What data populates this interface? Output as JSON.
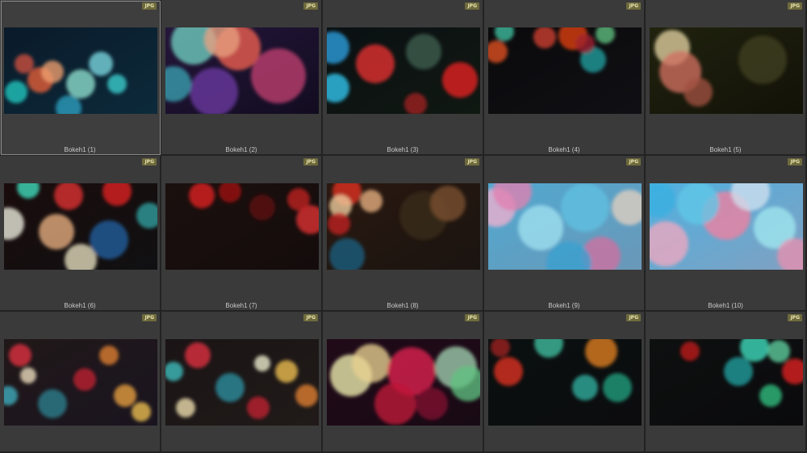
{
  "badge_label": "JPG",
  "items": [
    {
      "label": "Bokeh1 (1)",
      "selected": true,
      "bg": [
        "#0a1a2a",
        "#0c2a3a"
      ],
      "blobs": [
        [
          "#1ec8c0",
          15,
          80,
          14
        ],
        [
          "#e8603a",
          45,
          65,
          16
        ],
        [
          "#f0a070",
          60,
          55,
          14
        ],
        [
          "#90e0d0",
          95,
          70,
          18
        ],
        [
          "#7ad8e0",
          120,
          45,
          15
        ],
        [
          "#2aa0c0",
          80,
          100,
          16
        ],
        [
          "#3cd0d0",
          140,
          70,
          12
        ],
        [
          "#d05040",
          25,
          45,
          12
        ]
      ]
    },
    {
      "label": "Bokeh1 (2)",
      "selected": false,
      "bg": [
        "#24163a",
        "#120c20"
      ],
      "blobs": [
        [
          "#6fd0c0",
          35,
          18,
          28
        ],
        [
          "#f06050",
          90,
          25,
          28
        ],
        [
          "#e8a080",
          70,
          15,
          22
        ],
        [
          "#c04070",
          140,
          60,
          34
        ],
        [
          "#6a3aa0",
          60,
          80,
          30
        ],
        [
          "#3aa0b0",
          10,
          70,
          22
        ]
      ]
    },
    {
      "label": "Bokeh1 (3)",
      "selected": false,
      "bg": [
        "#0a1012",
        "#101812"
      ],
      "blobs": [
        [
          "#30c8f0",
          10,
          75,
          18
        ],
        [
          "#e83030",
          60,
          45,
          24
        ],
        [
          "#e82020",
          165,
          65,
          22
        ],
        [
          "#2aa0e0",
          8,
          25,
          20
        ],
        [
          "#406050",
          120,
          30,
          22
        ],
        [
          "#a02020",
          110,
          95,
          14
        ]
      ]
    },
    {
      "label": "Bokeh1 (4)",
      "selected": false,
      "bg": [
        "#0a0a0c",
        "#101014"
      ],
      "blobs": [
        [
          "#e04010",
          105,
          10,
          18
        ],
        [
          "#e05020",
          10,
          30,
          14
        ],
        [
          "#40c0a0",
          20,
          5,
          12
        ],
        [
          "#60c080",
          145,
          8,
          12
        ],
        [
          "#d04030",
          70,
          12,
          14
        ],
        [
          "#20a0a0",
          130,
          40,
          16
        ],
        [
          "#a02030",
          120,
          20,
          12
        ]
      ]
    },
    {
      "label": "Bokeh1 (5)",
      "selected": false,
      "bg": [
        "#20220e",
        "#121208"
      ],
      "blobs": [
        [
          "#e0d0a0",
          28,
          25,
          22
        ],
        [
          "#d07060",
          38,
          55,
          26
        ],
        [
          "#a05040",
          60,
          80,
          18
        ],
        [
          "#404020",
          140,
          40,
          30
        ]
      ]
    },
    {
      "label": "Bokeh1 (6)",
      "selected": false,
      "bg": [
        "#1a0c0c",
        "#101012"
      ],
      "blobs": [
        [
          "#f0f0e0",
          5,
          50,
          20
        ],
        [
          "#e8e0c0",
          95,
          95,
          20
        ],
        [
          "#e8b080",
          65,
          60,
          22
        ],
        [
          "#e03030",
          80,
          15,
          18
        ],
        [
          "#e02020",
          140,
          10,
          18
        ],
        [
          "#30a0a0",
          180,
          40,
          16
        ],
        [
          "#40e0c0",
          30,
          5,
          14
        ],
        [
          "#2060a0",
          130,
          70,
          24
        ]
      ]
    },
    {
      "label": "Bokeh1 (7)",
      "selected": false,
      "bg": [
        "#1a100e",
        "#140c0c"
      ],
      "blobs": [
        [
          "#e02020",
          45,
          15,
          16
        ],
        [
          "#a01010",
          80,
          10,
          14
        ],
        [
          "#e03030",
          180,
          45,
          18
        ],
        [
          "#c02020",
          165,
          20,
          14
        ],
        [
          "#601010",
          120,
          30,
          16
        ]
      ]
    },
    {
      "label": "Bokeh1 (8)",
      "selected": false,
      "bg": [
        "#2a1810",
        "#1a1410"
      ],
      "blobs": [
        [
          "#e03020",
          25,
          10,
          18
        ],
        [
          "#f0d0a0",
          17,
          28,
          14
        ],
        [
          "#e8b080",
          55,
          22,
          14
        ],
        [
          "#1a6080",
          25,
          90,
          22
        ],
        [
          "#c02020",
          15,
          50,
          14
        ],
        [
          "#3a2a1a",
          120,
          40,
          30
        ],
        [
          "#7a5030",
          150,
          25,
          22
        ]
      ]
    },
    {
      "label": "Bokeh1 (9)",
      "selected": false,
      "bg": [
        "#50a8d0",
        "#6a98b8"
      ],
      "blobs": [
        [
          "#f0b0d0",
          10,
          30,
          24
        ],
        [
          "#a0e0f0",
          65,
          55,
          28
        ],
        [
          "#e080b0",
          30,
          10,
          24
        ],
        [
          "#60c0e0",
          120,
          30,
          30
        ],
        [
          "#d070a0",
          140,
          90,
          24
        ],
        [
          "#e0d0c0",
          175,
          30,
          22
        ],
        [
          "#3aa0d0",
          100,
          100,
          28
        ]
      ]
    },
    {
      "label": "Bokeh1 (10)",
      "selected": false,
      "bg": [
        "#50b0e0",
        "#80a0c0"
      ],
      "blobs": [
        [
          "#f0a8c0",
          20,
          75,
          28
        ],
        [
          "#f080a0",
          95,
          40,
          30
        ],
        [
          "#a0e8f0",
          155,
          55,
          26
        ],
        [
          "#d0e0f0",
          125,
          10,
          24
        ],
        [
          "#60c8e8",
          60,
          25,
          26
        ],
        [
          "#e890b0",
          180,
          90,
          22
        ],
        [
          "#3ab0e0",
          10,
          20,
          22
        ]
      ]
    },
    {
      "label": "",
      "selected": false,
      "bg": [
        "#201818",
        "#1a1420"
      ],
      "blobs": [
        [
          "#e03040",
          20,
          20,
          14
        ],
        [
          "#f0e0c0",
          30,
          45,
          10
        ],
        [
          "#e8a040",
          150,
          70,
          14
        ],
        [
          "#f0c050",
          170,
          90,
          12
        ],
        [
          "#2a8090",
          60,
          80,
          18
        ],
        [
          "#c02030",
          100,
          50,
          14
        ],
        [
          "#40b0c0",
          5,
          70,
          12
        ],
        [
          "#e08030",
          130,
          20,
          12
        ]
      ]
    },
    {
      "label": "",
      "selected": false,
      "bg": [
        "#1a1416",
        "#201a18"
      ],
      "blobs": [
        [
          "#f0e0b0",
          25,
          85,
          12
        ],
        [
          "#e03040",
          40,
          20,
          16
        ],
        [
          "#f0c050",
          150,
          40,
          14
        ],
        [
          "#2a90a0",
          80,
          60,
          18
        ],
        [
          "#e08030",
          175,
          70,
          14
        ],
        [
          "#c02030",
          115,
          85,
          14
        ],
        [
          "#40c0c0",
          10,
          40,
          12
        ],
        [
          "#f0f0d0",
          120,
          30,
          10
        ]
      ]
    },
    {
      "label": "",
      "selected": false,
      "bg": [
        "#200a18",
        "#180a14"
      ],
      "blobs": [
        [
          "#f0f0b0",
          30,
          45,
          26
        ],
        [
          "#e8d090",
          55,
          30,
          24
        ],
        [
          "#e02050",
          105,
          40,
          30
        ],
        [
          "#c01838",
          85,
          80,
          26
        ],
        [
          "#a0d0b0",
          160,
          35,
          26
        ],
        [
          "#60c080",
          175,
          55,
          22
        ],
        [
          "#801030",
          130,
          80,
          20
        ]
      ]
    },
    {
      "label": "",
      "selected": false,
      "bg": [
        "#0a1010",
        "#0c0c0e"
      ],
      "blobs": [
        [
          "#e08020",
          140,
          15,
          20
        ],
        [
          "#40c0a0",
          75,
          5,
          18
        ],
        [
          "#20a080",
          160,
          60,
          18
        ],
        [
          "#e03020",
          25,
          40,
          18
        ],
        [
          "#30b0a0",
          120,
          60,
          16
        ],
        [
          "#a02020",
          15,
          10,
          12
        ]
      ]
    },
    {
      "label": "",
      "selected": false,
      "bg": [
        "#0e1010",
        "#0a0a0c"
      ],
      "blobs": [
        [
          "#40e0c0",
          130,
          10,
          18
        ],
        [
          "#60d0a0",
          160,
          15,
          14
        ],
        [
          "#20a0a0",
          110,
          40,
          18
        ],
        [
          "#e02020",
          180,
          40,
          16
        ],
        [
          "#30c080",
          150,
          70,
          14
        ],
        [
          "#c01818",
          50,
          15,
          12
        ]
      ]
    }
  ]
}
